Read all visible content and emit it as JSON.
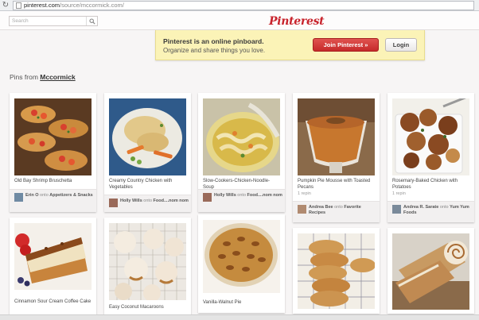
{
  "browser": {
    "url_host": "pinterest.com",
    "url_path": "/source/mccormick.com/"
  },
  "header": {
    "search_placeholder": "Search",
    "logo": "Pinterest"
  },
  "banner": {
    "headline": "Pinterest is an online pinboard.",
    "subline": "Organize and share things you love.",
    "join_label": "Join Pinterest »",
    "login_label": "Login"
  },
  "section": {
    "prefix": "Pins from ",
    "source": "Mccormick"
  },
  "pins": [
    {
      "desc": "Old Bay Shrimp Bruschetta",
      "repins": "",
      "user": "Erin O",
      "onto": "onto",
      "board": "Appetizers & Snacks"
    },
    {
      "desc": "Creamy Country Chicken with Vegetables",
      "repins": "",
      "user": "Holly Wills",
      "onto": "onto",
      "board": "Food....nom nom"
    },
    {
      "desc": "Slow-Cookers-Chicken-Noodle-Soup",
      "repins": "",
      "user": "Holly Wills",
      "onto": "onto",
      "board": "Food....nom nom"
    },
    {
      "desc": "Pumpkin Pie Mousse with Toasted Pecans",
      "repins": "1 repin",
      "user": "Andrea Bee",
      "onto": "onto",
      "board": "Favorite Recipes"
    },
    {
      "desc": "Rosemary-Baked Chicken with Potatoes",
      "repins": "1 repin",
      "user": "Andrea R. Sarate",
      "onto": "onto",
      "board": "Yum Yum Foods"
    },
    {
      "desc": "Cinnamon Sour Cream Coffee Cake",
      "repins": ""
    },
    {
      "desc": "Easy Coconut Macaroons",
      "repins": ""
    },
    {
      "desc": "Vanilla-Walnut Pie",
      "repins": ""
    },
    {
      "desc": "",
      "repins": ""
    },
    {
      "desc": "",
      "repins": ""
    }
  ],
  "colors": {
    "brand_red": "#c8232c",
    "banner_bg": "#fbf3b7",
    "page_bg": "#f7f5f5"
  },
  "icons": {
    "search": "magnifier-icon",
    "reload": "reload-icon"
  }
}
